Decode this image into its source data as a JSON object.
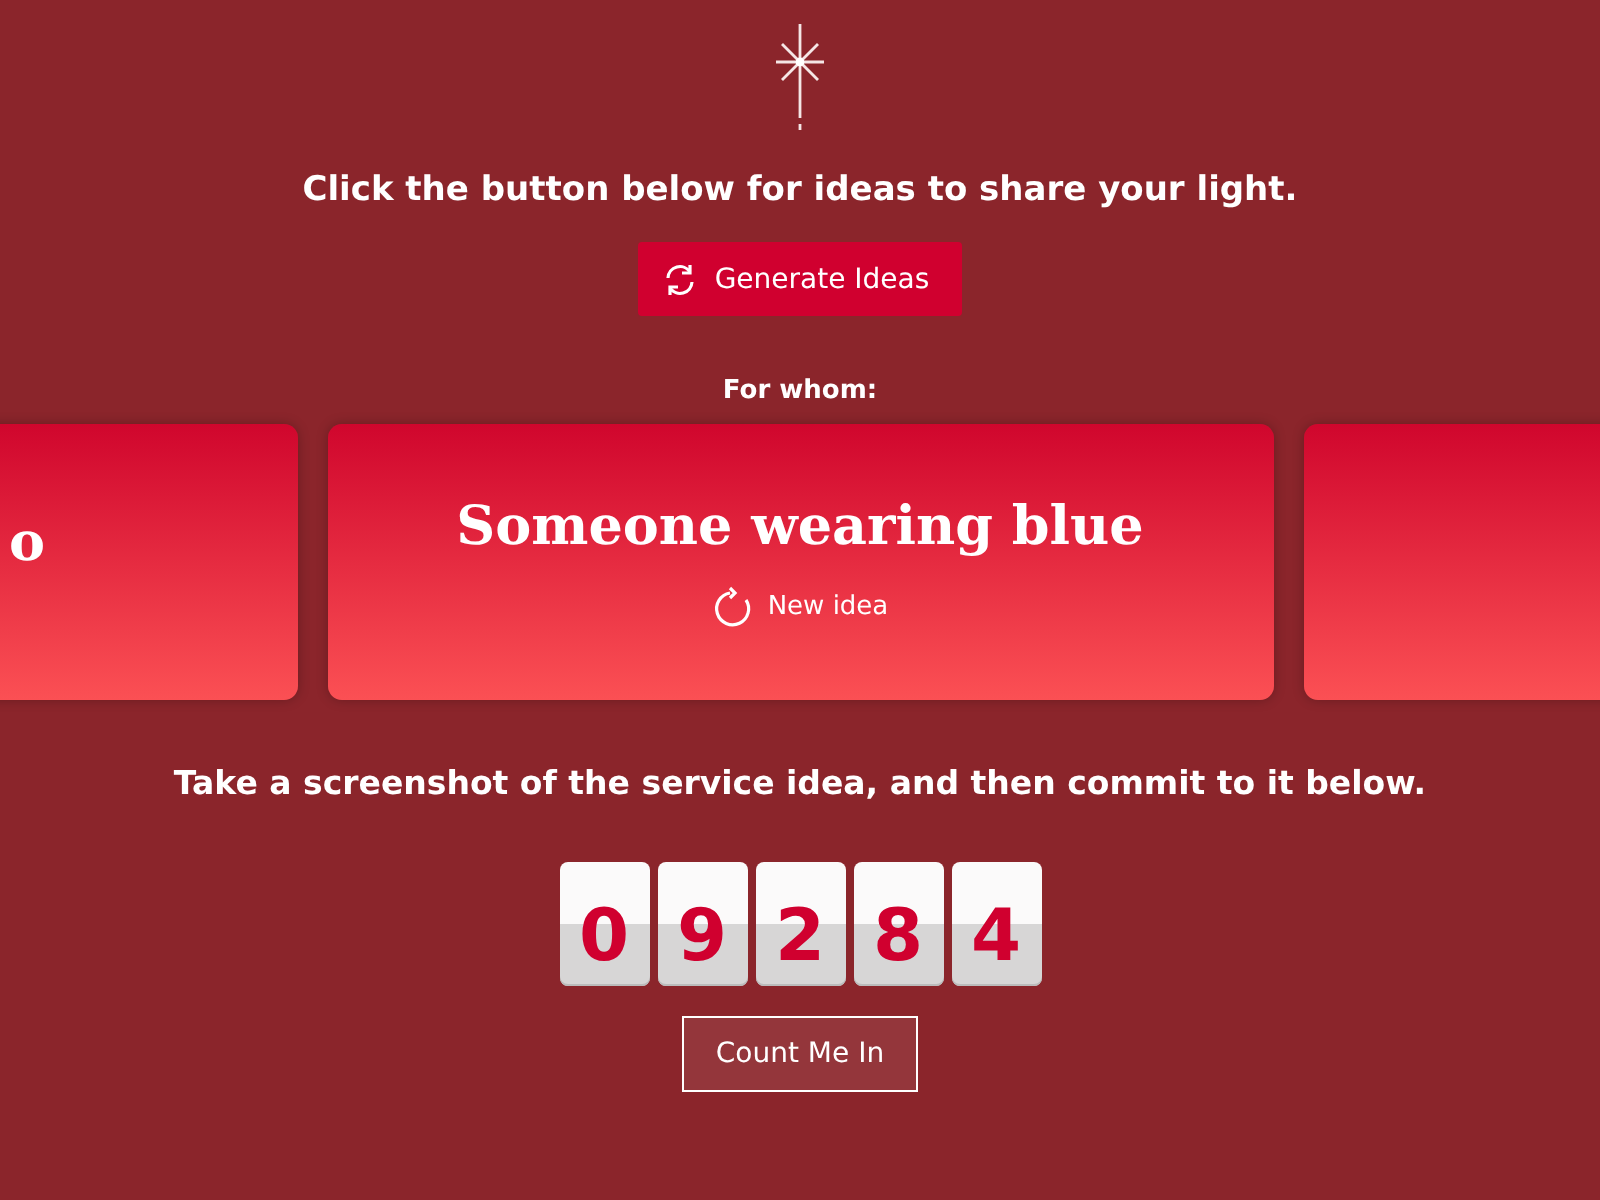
{
  "prompt": "Click the button below for ideas to share your light.",
  "generate_button": "Generate Ideas",
  "for_whom_label": "For whom:",
  "cards": [
    {
      "text": "o",
      "kind": "previous"
    },
    {
      "text": "Someone wearing blue",
      "kind": "current",
      "action": "New idea"
    },
    {
      "kind": "next"
    }
  ],
  "instruction": "Take a screenshot of the service idea, and then commit to it below.",
  "counter": [
    "0",
    "9",
    "2",
    "8",
    "4"
  ],
  "commit_button": "Count Me In"
}
